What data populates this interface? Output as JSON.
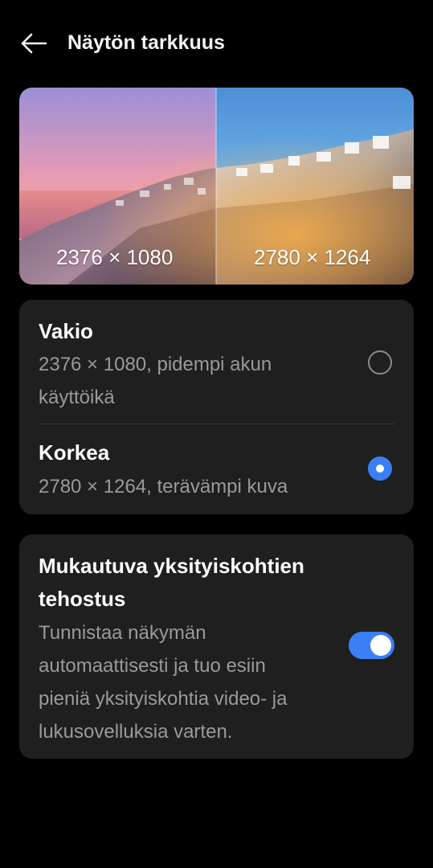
{
  "header": {
    "title": "Näytön tarkkuus",
    "back_icon": "back-arrow-icon"
  },
  "preview": {
    "left_label": "2376 × 1080",
    "right_label": "2780 × 1264"
  },
  "resolution": {
    "options": [
      {
        "title": "Vakio",
        "description_line1": "2376 × 1080, pidempi akun",
        "description_line2": "käyttöikä",
        "selected": false
      },
      {
        "title": "Korkea",
        "description": "2780 × 1264, terävämpi kuva",
        "selected": true
      }
    ]
  },
  "detail_enhancement": {
    "title_line1": "Mukautuva yksityiskohtien",
    "title_line2": "tehostus",
    "description_lines": [
      "Tunnistaa näkymän",
      "automaattisesti ja tuo esiin",
      "pieniä yksityiskohtia video- ja",
      "lukusovelluksia varten."
    ],
    "enabled": true
  },
  "colors": {
    "background": "#000000",
    "card": "#1f1f1f",
    "accent": "#3a7ff6",
    "secondary_text": "#9a9a9a"
  }
}
